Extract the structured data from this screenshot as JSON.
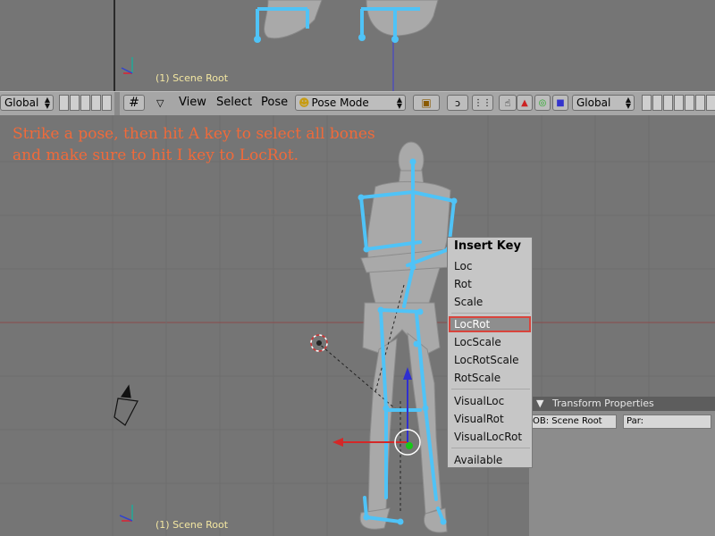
{
  "top_viewport": {
    "scene_label": "(1) Scene Root"
  },
  "main_viewport": {
    "scene_label": "(1) Scene Root"
  },
  "header": {
    "left_orientation": "Global",
    "menus": [
      "View",
      "Select",
      "Pose"
    ],
    "mode": "Pose Mode",
    "orientation": "Global"
  },
  "annotation": {
    "line1": "Strike a pose, then hit A key to select all bones",
    "line2": "and make sure to hit I key to LocRot."
  },
  "insert_key_menu": {
    "title": "Insert Key",
    "items": [
      "Loc",
      "Rot",
      "Scale",
      "LocRot",
      "LocScale",
      "LocRotScale",
      "RotScale",
      "VisualLoc",
      "VisualRot",
      "VisualLocRot",
      "Available"
    ],
    "selected": "LocRot"
  },
  "transform_panel": {
    "title": "Transform Properties",
    "ob_field": "OB: Scene Root",
    "par_field": "Par:"
  },
  "colors": {
    "bone": "#4fc3f7",
    "accent_highlight": "#d8443c",
    "annotation": "#f06a3a",
    "scene_label": "#f3e7a2"
  }
}
